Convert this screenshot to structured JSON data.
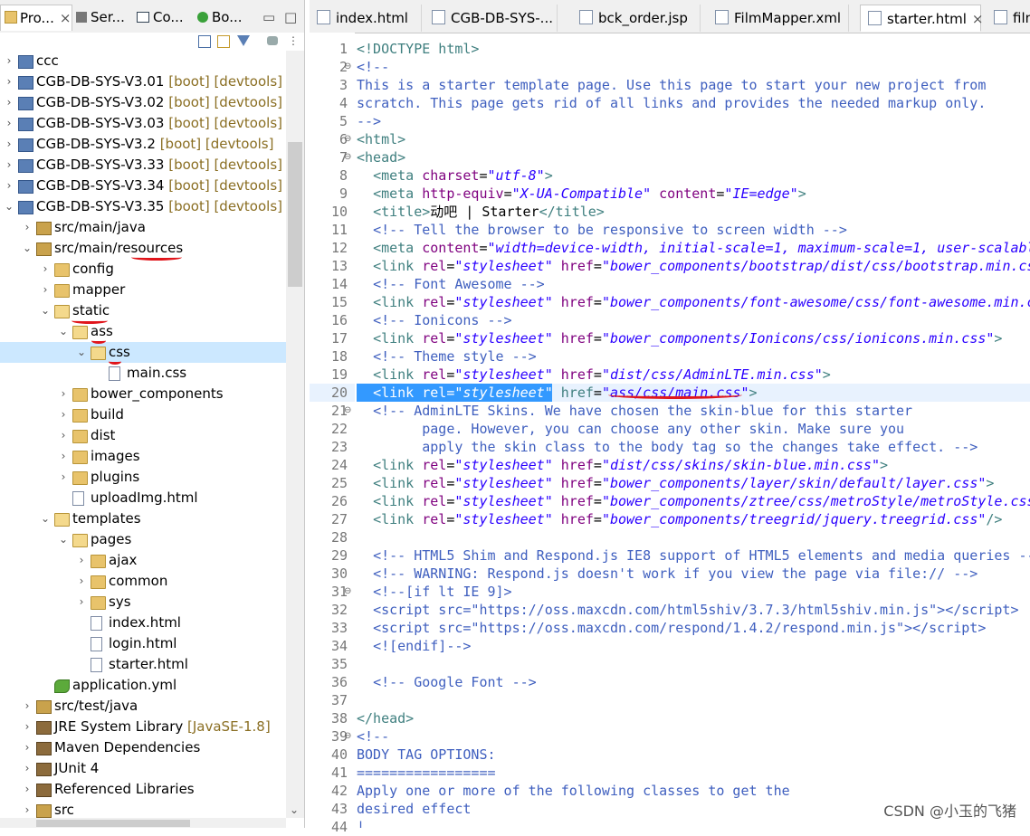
{
  "left_panel": {
    "tabs": [
      {
        "label": "Pro...",
        "close": "×"
      },
      {
        "label": "Ser..."
      },
      {
        "label": "Co..."
      },
      {
        "label": "Bo..."
      }
    ],
    "win_min": "▭",
    "win_max": "□",
    "tree": [
      {
        "label": "ccc",
        "tag": "",
        "depth": 0,
        "arrow": "›",
        "icon": "proj"
      },
      {
        "label": "CGB-DB-SYS-V3.01",
        "tag": " [boot] [devtools]",
        "depth": 0,
        "arrow": "›",
        "icon": "proj"
      },
      {
        "label": "CGB-DB-SYS-V3.02",
        "tag": " [boot] [devtools]",
        "depth": 0,
        "arrow": "›",
        "icon": "proj"
      },
      {
        "label": "CGB-DB-SYS-V3.03",
        "tag": " [boot] [devtools]",
        "depth": 0,
        "arrow": "›",
        "icon": "proj"
      },
      {
        "label": "CGB-DB-SYS-V3.2",
        "tag": " [boot] [devtools]",
        "depth": 0,
        "arrow": "›",
        "icon": "proj"
      },
      {
        "label": "CGB-DB-SYS-V3.33",
        "tag": " [boot] [devtools]",
        "depth": 0,
        "arrow": "›",
        "icon": "proj"
      },
      {
        "label": "CGB-DB-SYS-V3.34",
        "tag": " [boot] [devtools]",
        "depth": 0,
        "arrow": "›",
        "icon": "proj"
      },
      {
        "label": "CGB-DB-SYS-V3.35",
        "tag": " [boot] [devtools]",
        "depth": 0,
        "arrow": "⌄",
        "icon": "proj"
      },
      {
        "label": "src/main/java",
        "tag": "",
        "depth": 1,
        "arrow": "›",
        "icon": "pkg"
      },
      {
        "label": "src/main/resources",
        "tag": "",
        "depth": 1,
        "arrow": "⌄",
        "icon": "pkg"
      },
      {
        "label": "config",
        "tag": "",
        "depth": 2,
        "arrow": "›",
        "icon": "folder"
      },
      {
        "label": "mapper",
        "tag": "",
        "depth": 2,
        "arrow": "›",
        "icon": "folder"
      },
      {
        "label": "static",
        "tag": "",
        "depth": 2,
        "arrow": "⌄",
        "icon": "folder open"
      },
      {
        "label": "ass",
        "tag": "",
        "depth": 3,
        "arrow": "⌄",
        "icon": "folder open"
      },
      {
        "label": "css",
        "tag": "",
        "depth": 4,
        "arrow": "⌄",
        "icon": "folder open"
      },
      {
        "label": "main.css",
        "tag": "",
        "depth": 5,
        "arrow": "",
        "icon": "file"
      },
      {
        "label": "bower_components",
        "tag": "",
        "depth": 3,
        "arrow": "›",
        "icon": "folder"
      },
      {
        "label": "build",
        "tag": "",
        "depth": 3,
        "arrow": "›",
        "icon": "folder"
      },
      {
        "label": "dist",
        "tag": "",
        "depth": 3,
        "arrow": "›",
        "icon": "folder"
      },
      {
        "label": "images",
        "tag": "",
        "depth": 3,
        "arrow": "›",
        "icon": "folder"
      },
      {
        "label": "plugins",
        "tag": "",
        "depth": 3,
        "arrow": "›",
        "icon": "folder"
      },
      {
        "label": "uploadImg.html",
        "tag": "",
        "depth": 3,
        "arrow": "",
        "icon": "file"
      },
      {
        "label": "templates",
        "tag": "",
        "depth": 2,
        "arrow": "⌄",
        "icon": "folder open"
      },
      {
        "label": "pages",
        "tag": "",
        "depth": 3,
        "arrow": "⌄",
        "icon": "folder open"
      },
      {
        "label": "ajax",
        "tag": "",
        "depth": 4,
        "arrow": "›",
        "icon": "folder"
      },
      {
        "label": "common",
        "tag": "",
        "depth": 4,
        "arrow": "›",
        "icon": "folder"
      },
      {
        "label": "sys",
        "tag": "",
        "depth": 4,
        "arrow": "›",
        "icon": "folder"
      },
      {
        "label": "index.html",
        "tag": "",
        "depth": 4,
        "arrow": "",
        "icon": "file"
      },
      {
        "label": "login.html",
        "tag": "",
        "depth": 4,
        "arrow": "",
        "icon": "file"
      },
      {
        "label": "starter.html",
        "tag": "",
        "depth": 4,
        "arrow": "",
        "icon": "file"
      },
      {
        "label": "application.yml",
        "tag": "",
        "depth": 2,
        "arrow": "",
        "icon": "yml"
      },
      {
        "label": "src/test/java",
        "tag": "",
        "depth": 1,
        "arrow": "›",
        "icon": "pkg"
      },
      {
        "label": "JRE System Library",
        "tag": " [JavaSE-1.8]",
        "depth": 1,
        "arrow": "›",
        "icon": "lib"
      },
      {
        "label": "Maven Dependencies",
        "tag": "",
        "depth": 1,
        "arrow": "›",
        "icon": "lib"
      },
      {
        "label": "JUnit 4",
        "tag": "",
        "depth": 1,
        "arrow": "›",
        "icon": "lib"
      },
      {
        "label": "Referenced Libraries",
        "tag": "",
        "depth": 1,
        "arrow": "›",
        "icon": "lib"
      },
      {
        "label": "src",
        "tag": "",
        "depth": 1,
        "arrow": "›",
        "icon": "pkg"
      }
    ]
  },
  "editor": {
    "tabs": [
      {
        "label": "index.html"
      },
      {
        "label": "CGB-DB-SYS-..."
      },
      {
        "label": "bck_order.jsp"
      },
      {
        "label": "FilmMapper.xml"
      },
      {
        "label": "starter.html",
        "active": true,
        "close": "×"
      },
      {
        "label": "filmI"
      }
    ],
    "lines": [
      {
        "n": "1",
        "fold": "",
        "html": "<span class='t'>&lt;!DOCTYPE html&gt;</span>"
      },
      {
        "n": "2",
        "fold": "⊖",
        "html": "<span class='c'>&lt;!--</span>"
      },
      {
        "n": "3",
        "fold": "",
        "html": "<span class='c'>This is a starter template page. Use this page to start your new project from</span>"
      },
      {
        "n": "4",
        "fold": "",
        "html": "<span class='c'>scratch. This page gets rid of all links and provides the needed markup only.</span>"
      },
      {
        "n": "5",
        "fold": "",
        "html": "<span class='c'>--&gt;</span>"
      },
      {
        "n": "6",
        "fold": "⊖",
        "html": "<span class='t'>&lt;html&gt;</span>"
      },
      {
        "n": "7",
        "fold": "⊖",
        "html": "<span class='t'>&lt;head&gt;</span>"
      },
      {
        "n": "8",
        "fold": "",
        "html": "  <span class='t'>&lt;meta</span> <span class='a'>charset</span>=<span class='v'>\"utf-8\"</span><span class='t'>&gt;</span>"
      },
      {
        "n": "9",
        "fold": "",
        "html": "  <span class='t'>&lt;meta</span> <span class='a'>http-equiv</span>=<span class='v'>\"X-UA-Compatible\"</span> <span class='a'>content</span>=<span class='v'>\"IE=edge\"</span><span class='t'>&gt;</span>"
      },
      {
        "n": "10",
        "fold": "",
        "html": "  <span class='t'>&lt;title&gt;</span>动吧 | Starter<span class='t'>&lt;/title&gt;</span>"
      },
      {
        "n": "11",
        "fold": "",
        "html": "  <span class='c'>&lt;!-- Tell the browser to be responsive to screen width --&gt;</span>"
      },
      {
        "n": "12",
        "fold": "",
        "html": "  <span class='t'>&lt;meta</span> <span class='a'>content</span>=<span class='v'>\"width=device-width, initial-scale=1, maximum-scale=1, user-scalable</span>"
      },
      {
        "n": "13",
        "fold": "",
        "html": "  <span class='t'>&lt;link</span> <span class='a'>rel</span>=<span class='v'>\"stylesheet\"</span> <span class='a'>href</span>=<span class='v'>\"bower_components/bootstrap/dist/css/bootstrap.min.css</span>"
      },
      {
        "n": "14",
        "fold": "",
        "html": "  <span class='c'>&lt;!-- Font Awesome --&gt;</span>"
      },
      {
        "n": "15",
        "fold": "",
        "html": "  <span class='t'>&lt;link</span> <span class='a'>rel</span>=<span class='v'>\"stylesheet\"</span> <span class='a'>href</span>=<span class='v'>\"bower_components/font-awesome/css/font-awesome.min.c</span>"
      },
      {
        "n": "16",
        "fold": "",
        "html": "  <span class='c'>&lt;!-- Ionicons --&gt;</span>"
      },
      {
        "n": "17",
        "fold": "",
        "html": "  <span class='t'>&lt;link</span> <span class='a'>rel</span>=<span class='v'>\"stylesheet\"</span> <span class='a'>href</span>=<span class='v'>\"bower_components/Ionicons/css/ionicons.min.css\"</span><span class='t'>&gt;</span>"
      },
      {
        "n": "18",
        "fold": "",
        "html": "  <span class='c'>&lt;!-- Theme style --&gt;</span>"
      },
      {
        "n": "19",
        "fold": "",
        "html": "  <span class='t'>&lt;link</span> <span class='a'>rel</span>=<span class='v'>\"stylesheet\"</span> <span class='a'>href</span>=<span class='v'>\"dist/css/AdminLTE.min.css\"</span><span class='t'>&gt;</span>"
      },
      {
        "n": "20",
        "fold": "",
        "html": "  <span style='color:#fff'>&lt;link rel=<i>\"stylesheet\"</i></span> <span class='t'>href</span>=<span class='v'>\"ass/css/main.css\"</span><span class='t'>&gt;</span>"
      },
      {
        "n": "21",
        "fold": "⊖",
        "html": "  <span class='c'>&lt;!-- AdminLTE Skins. We have chosen the skin-blue for this starter</span>"
      },
      {
        "n": "22",
        "fold": "",
        "html": "<span class='c'>        page. However, you can choose any other skin. Make sure you</span>"
      },
      {
        "n": "23",
        "fold": "",
        "html": "<span class='c'>        apply the skin class to the body tag so the changes take effect. --&gt;</span>"
      },
      {
        "n": "24",
        "fold": "",
        "html": "  <span class='t'>&lt;link</span> <span class='a'>rel</span>=<span class='v'>\"stylesheet\"</span> <span class='a'>href</span>=<span class='v'>\"dist/css/skins/skin-blue.min.css\"</span><span class='t'>&gt;</span>"
      },
      {
        "n": "25",
        "fold": "",
        "html": "  <span class='t'>&lt;link</span> <span class='a'>rel</span>=<span class='v'>\"stylesheet\"</span> <span class='a'>href</span>=<span class='v'>\"bower_components/layer/skin/default/layer.css\"</span><span class='t'>&gt;</span>"
      },
      {
        "n": "26",
        "fold": "",
        "html": "  <span class='t'>&lt;link</span> <span class='a'>rel</span>=<span class='v'>\"stylesheet\"</span> <span class='a'>href</span>=<span class='v'>\"bower_components/ztree/css/metroStyle/metroStyle.css</span>"
      },
      {
        "n": "27",
        "fold": "",
        "html": "  <span class='t'>&lt;link</span> <span class='a'>rel</span>=<span class='v'>\"stylesheet\"</span> <span class='a'>href</span>=<span class='v'>\"bower_components/treegrid/jquery.treegrid.css\"</span><span class='t'>/&gt;</span>"
      },
      {
        "n": "28",
        "fold": "",
        "html": ""
      },
      {
        "n": "29",
        "fold": "",
        "html": "  <span class='c'>&lt;!-- HTML5 Shim and Respond.js IE8 support of HTML5 elements and media queries --</span>"
      },
      {
        "n": "30",
        "fold": "",
        "html": "  <span class='c'>&lt;!-- WARNING: Respond.js doesn't work if you view the page via file:// --&gt;</span>"
      },
      {
        "n": "31",
        "fold": "⊖",
        "html": "  <span class='c'>&lt;!--[if lt IE 9]&gt;</span>"
      },
      {
        "n": "32",
        "fold": "",
        "html": "  <span class='c'>&lt;script src=\"https://oss.maxcdn.com/html5shiv/3.7.3/html5shiv.min.js\"&gt;&lt;/script&gt;</span>"
      },
      {
        "n": "33",
        "fold": "",
        "html": "  <span class='c'>&lt;script src=\"https://oss.maxcdn.com/respond/1.4.2/respond.min.js\"&gt;&lt;/script&gt;</span>"
      },
      {
        "n": "34",
        "fold": "",
        "html": "  <span class='c'>&lt;![endif]--&gt;</span>"
      },
      {
        "n": "35",
        "fold": "",
        "html": ""
      },
      {
        "n": "36",
        "fold": "",
        "html": "  <span class='c'>&lt;!-- Google Font --&gt;</span>"
      },
      {
        "n": "37",
        "fold": "",
        "html": ""
      },
      {
        "n": "38",
        "fold": "",
        "html": "<span class='t'>&lt;/head&gt;</span>"
      },
      {
        "n": "39",
        "fold": "⊖",
        "html": "<span class='c'>&lt;!--</span>"
      },
      {
        "n": "40",
        "fold": "",
        "html": "<span class='c'>BODY TAG OPTIONS:</span>"
      },
      {
        "n": "41",
        "fold": "",
        "html": "<span class='c'>=================</span>"
      },
      {
        "n": "42",
        "fold": "",
        "html": "<span class='c'>Apply one or more of the following classes to get the</span>"
      },
      {
        "n": "43",
        "fold": "",
        "html": "<span class='c'>desired effect</span>"
      },
      {
        "n": "44",
        "fold": "",
        "html": "<span class='c'>|</span>"
      }
    ]
  },
  "watermark": "CSDN @小玉的飞猪",
  "colors": {
    "highlight_line": "#e8f2fe",
    "selection": "#3399ff",
    "annotation_red": "#e0151b"
  }
}
